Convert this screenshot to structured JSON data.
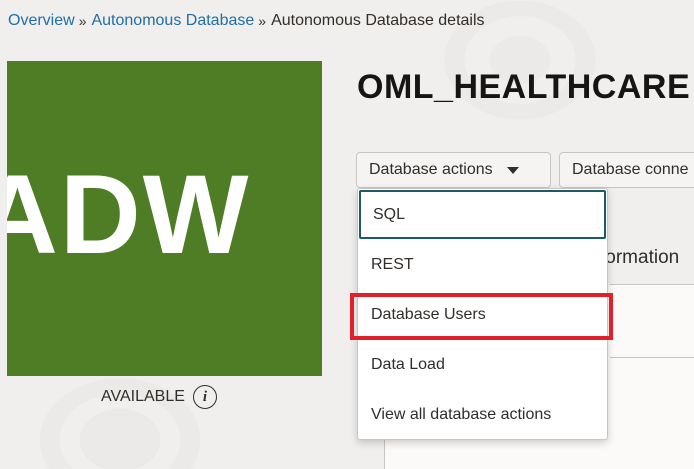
{
  "breadcrumb": {
    "items": [
      "Overview",
      "Autonomous Database"
    ],
    "separator": "»",
    "current": "Autonomous Database details"
  },
  "tile": {
    "text": "ADW",
    "color": "#4f7d25"
  },
  "status": {
    "text": "AVAILABLE",
    "icon": "info-icon"
  },
  "title": "OML_HEALTHCARE",
  "toolbar": {
    "actions_label": "Database actions",
    "connection_label": "Database conne"
  },
  "tab_partial": "formation",
  "menu": {
    "items": [
      "SQL",
      "REST",
      "Database Users",
      "Data Load",
      "View all database actions"
    ],
    "focused": "SQL",
    "highlighted": "Database Users",
    "highlight_color": "#e0202a"
  }
}
